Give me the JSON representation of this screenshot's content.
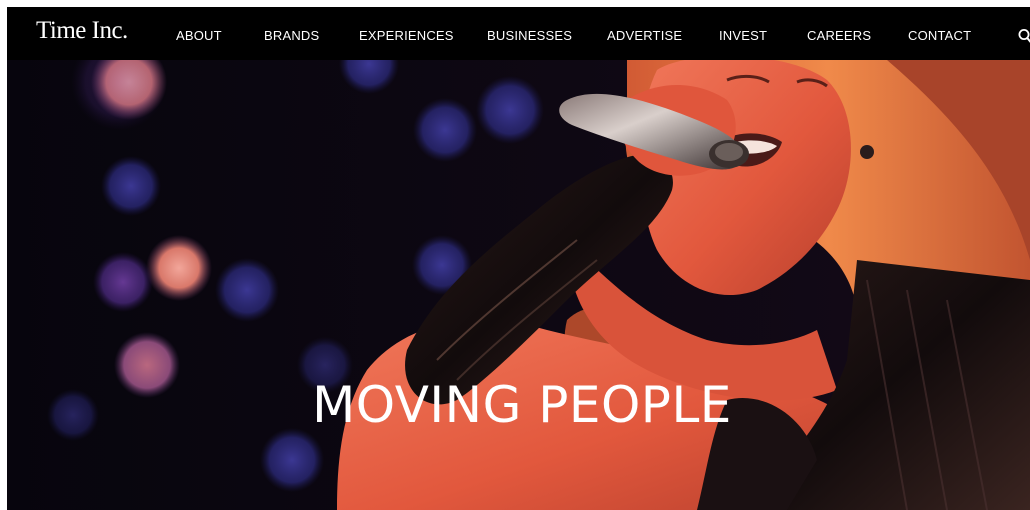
{
  "brand": {
    "logo_text": "Time Inc."
  },
  "nav": {
    "items": [
      {
        "label": "ABOUT"
      },
      {
        "label": "BRANDS"
      },
      {
        "label": "EXPERIENCES"
      },
      {
        "label": "BUSINESSES"
      },
      {
        "label": "ADVERTISE"
      },
      {
        "label": "INVEST"
      },
      {
        "label": "CAREERS"
      },
      {
        "label": "CONTACT"
      }
    ],
    "search_icon": "search-icon"
  },
  "hero": {
    "headline": "MOVING PEOPLE",
    "image_subject": "singer-with-microphone-photo"
  },
  "colors": {
    "nav_background": "#000000",
    "nav_text": "#ffffff",
    "headline_text": "#ffffff",
    "hero_tint": "#e2533b"
  }
}
